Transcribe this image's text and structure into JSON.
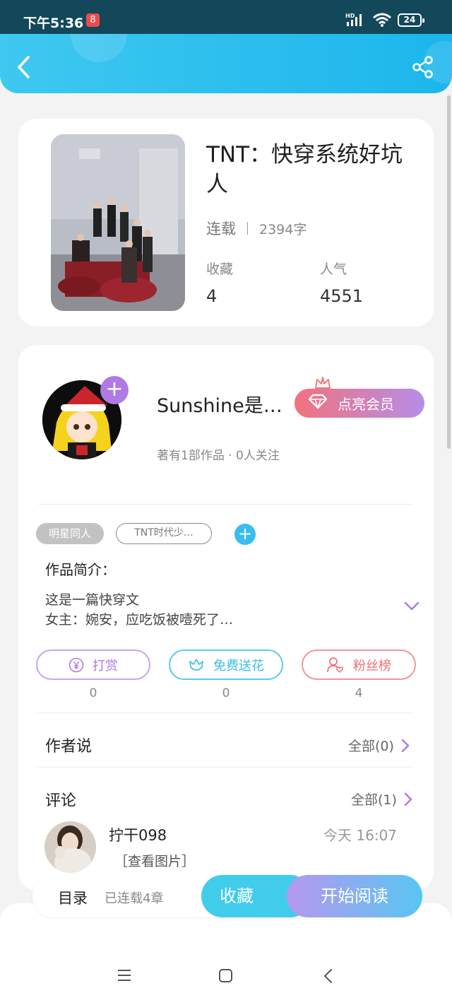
{
  "status_bar": {
    "time": "下午5:36",
    "app_badge": "8",
    "network": "HD",
    "battery": "24"
  },
  "header": {
    "back_icon": "chevron-left-icon",
    "share_icon": "share-icon"
  },
  "book": {
    "title": "TNT：快穿系统好坑人",
    "status": "连载",
    "word_count": "2394字",
    "favorites_label": "收藏",
    "favorites_value": "4",
    "popularity_label": "人气",
    "popularity_value": "4551"
  },
  "author": {
    "name": "Sunshine是…",
    "subtitle": "著有1部作品 · 0人关注",
    "follow_icon": "plus-icon",
    "vip_button": "点亮会员"
  },
  "tags": {
    "category": "明星同人",
    "tag": "TNT时代少…",
    "add_icon": "plus-icon"
  },
  "intro": {
    "heading": "作品简介：",
    "line1": "这是一篇快穿文",
    "line2": "女主：婉安，应吃饭被噎死了…"
  },
  "actions": [
    {
      "label": "打赏",
      "count": "0",
      "icon": "yen-coin-icon",
      "color": "#b07ae5"
    },
    {
      "label": "免费送花",
      "count": "0",
      "icon": "flower-icon",
      "color": "#38bfe8"
    },
    {
      "label": "粉丝榜",
      "count": "4",
      "icon": "fan-user-icon",
      "color": "#ee6f78"
    }
  ],
  "author_says": {
    "title": "作者说",
    "more": "全部(0)"
  },
  "comments": {
    "title": "评论",
    "more": "全部(1)",
    "items": [
      {
        "user": "拧干098",
        "time": "今天 16:07",
        "text": "［查看图片］"
      }
    ]
  },
  "bottom_bar": {
    "toc_label": "目录",
    "toc_count": "已连载4章",
    "collect": "收藏",
    "read": "开始阅读"
  },
  "colors": {
    "header": "#1cb6ec",
    "accent_purple": "#b07ae5",
    "accent_blue": "#38bfe8",
    "accent_red": "#ee6f78"
  }
}
